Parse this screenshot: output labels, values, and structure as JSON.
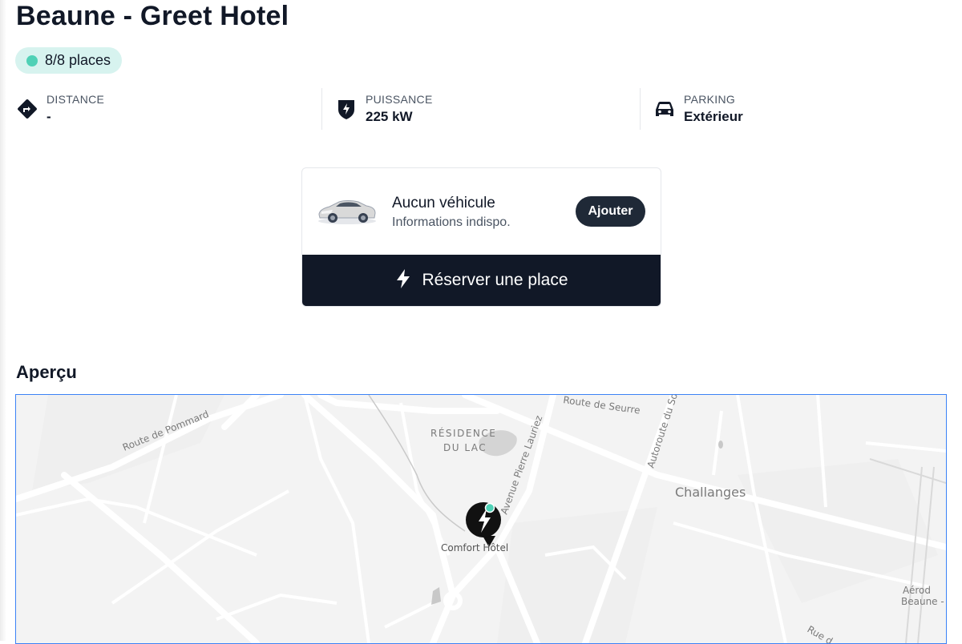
{
  "station": {
    "title": "Beaune - Greet Hotel",
    "availability": "8/8 places"
  },
  "info": [
    {
      "label": "DISTANCE",
      "value": "-",
      "icon": "direction-icon"
    },
    {
      "label": "PUISSANCE",
      "value": "225 kW",
      "icon": "bolt-shield-icon"
    },
    {
      "label": "PARKING",
      "value": "Extérieur",
      "icon": "car-icon"
    }
  ],
  "vehicle": {
    "title": "Aucun véhicule",
    "subtitle": "Informations indispo.",
    "add_label": "Ajouter"
  },
  "reserve": {
    "label": "Réserver une place"
  },
  "overview": {
    "title": "Aperçu"
  },
  "map": {
    "labels": {
      "road_pommard": "Route de Pommard",
      "road_seurre": "Route de Seurre",
      "residence_1": "RÉSIDENCE",
      "residence_2": "DU LAC",
      "avenue": "Avenue Pierre Lauriez",
      "autoroute": "Autoroute du Sol",
      "challanges": "Challanges",
      "marker": "Comfort Hôtel",
      "aero": "Aérod",
      "beaune": "Beaune -",
      "rue": "Rue d"
    }
  },
  "colors": {
    "badge_bg": "#d7f3ef",
    "badge_dot": "#4fd1b6",
    "dark": "#111827",
    "map_border": "#3b82f6"
  }
}
